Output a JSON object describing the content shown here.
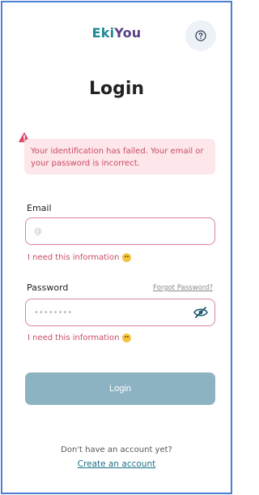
{
  "app": {
    "logo_part1": "Eki",
    "logo_part2": "You"
  },
  "page": {
    "title": "Login"
  },
  "error": {
    "message": "Your identification has failed. Your email or your password is incorrect."
  },
  "email": {
    "label": "Email",
    "placeholder": "@",
    "value": "",
    "error": "I need this information"
  },
  "password": {
    "label": "Password",
    "placeholder": "••••••••",
    "value": "",
    "error": "I need this information",
    "forgot_label": "Forgot Password?"
  },
  "login_button": {
    "label": "Login"
  },
  "footer": {
    "no_account": "Don't have an account yet?",
    "create_link": "Create an account"
  },
  "icons": {
    "help": "question-circle-icon",
    "warning": "warning-triangle-icon",
    "eye": "eye-slash-icon",
    "emoji": "emoji-face-icon"
  },
  "colors": {
    "accent_teal": "#1e8a93",
    "accent_purple": "#5a3f86",
    "error": "#c94a63",
    "error_bg": "#fde7ea",
    "button": "#8db3c2",
    "link": "#1e6f86"
  }
}
